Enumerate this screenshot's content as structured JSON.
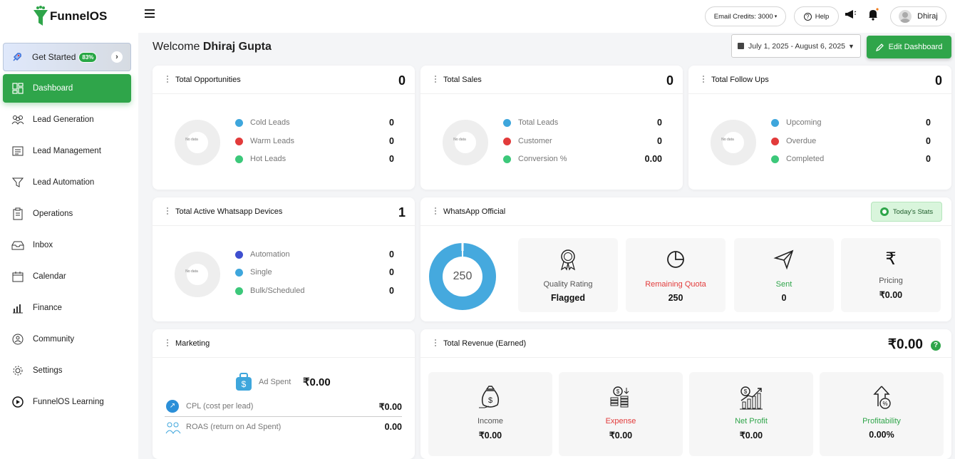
{
  "brand": {
    "name": "FunnelOS"
  },
  "sidebar": {
    "get_started": {
      "label": "Get Started",
      "badge": "83%"
    },
    "items": [
      {
        "label": "Dashboard",
        "icon": "dashboard-icon"
      },
      {
        "label": "Lead Generation",
        "icon": "users-icon"
      },
      {
        "label": "Lead Management",
        "icon": "list-icon"
      },
      {
        "label": "Lead Automation",
        "icon": "funnel-icon"
      },
      {
        "label": "Operations",
        "icon": "clipboard-icon"
      },
      {
        "label": "Inbox",
        "icon": "inbox-icon"
      },
      {
        "label": "Calendar",
        "icon": "calendar-icon"
      },
      {
        "label": "Finance",
        "icon": "bar-chart-icon"
      },
      {
        "label": "Community",
        "icon": "community-icon"
      },
      {
        "label": "Settings",
        "icon": "gear-icon"
      },
      {
        "label": "FunnelOS Learning",
        "icon": "play-icon"
      }
    ]
  },
  "topbar": {
    "email_credits": "Email Credits: 3000",
    "help": "Help",
    "user": "Dhiraj"
  },
  "header": {
    "welcome": "Welcome",
    "name": "Dhiraj Gupta",
    "date_range": "July 1, 2025 - August 6, 2025",
    "edit_label": "Edit Dashboard"
  },
  "colors": {
    "accent": "#2fa54a",
    "blue": "#3ea6dc",
    "red": "#e23b3b",
    "green": "#3cc87a",
    "indigo": "#3e4fcf"
  },
  "cards": {
    "opportunities": {
      "title": "Total Opportunities",
      "value": "0",
      "donut": "No data",
      "legend": [
        {
          "label": "Cold Leads",
          "value": "0"
        },
        {
          "label": "Warm Leads",
          "value": "0"
        },
        {
          "label": "Hot Leads",
          "value": "0"
        }
      ]
    },
    "sales": {
      "title": "Total Sales",
      "value": "0",
      "donut": "No data",
      "legend": [
        {
          "label": "Total Leads",
          "value": "0"
        },
        {
          "label": "Customer",
          "value": "0"
        },
        {
          "label": "Conversion %",
          "value": "0.00"
        }
      ]
    },
    "followups": {
      "title": "Total Follow Ups",
      "value": "0",
      "donut": "No data",
      "legend": [
        {
          "label": "Upcoming",
          "value": "0"
        },
        {
          "label": "Overdue",
          "value": "0"
        },
        {
          "label": "Completed",
          "value": "0"
        }
      ]
    },
    "whatsapp_devices": {
      "title": "Total Active Whatsapp Devices",
      "value": "1",
      "donut": "No data",
      "legend": [
        {
          "label": "Automation",
          "value": "0"
        },
        {
          "label": "Single",
          "value": "0"
        },
        {
          "label": "Bulk/Scheduled",
          "value": "0"
        }
      ]
    },
    "whatsapp_official": {
      "title": "WhatsApp Official",
      "today_stats": "Today's Stats",
      "ring_value": "250",
      "tiles": [
        {
          "label": "Quality Rating",
          "value": "Flagged",
          "icon": "award-icon"
        },
        {
          "label": "Remaining Quota",
          "value": "250",
          "icon": "pie-icon"
        },
        {
          "label": "Sent",
          "value": "0",
          "icon": "send-icon"
        },
        {
          "label": "Pricing",
          "value": "₹0.00",
          "icon": "rupee-icon"
        }
      ]
    },
    "marketing": {
      "title": "Marketing",
      "ad_spent_label": "Ad Spent",
      "ad_spent_value": "₹0.00",
      "cpl_label": "CPL (cost per lead)",
      "cpl_value": "₹0.00",
      "roas_label": "ROAS (return on Ad Spent)",
      "roas_value": "0.00"
    },
    "revenue": {
      "title": "Total Revenue (Earned)",
      "value": "₹0.00",
      "tiles": [
        {
          "label": "Income",
          "value": "₹0.00",
          "icon": "money-bag-icon"
        },
        {
          "label": "Expense",
          "value": "₹0.00",
          "icon": "coins-icon"
        },
        {
          "label": "Net Profit",
          "value": "₹0.00",
          "icon": "growth-chart-icon"
        },
        {
          "label": "Profitability",
          "value": "0.00%",
          "icon": "percent-arrow-icon"
        }
      ]
    }
  }
}
